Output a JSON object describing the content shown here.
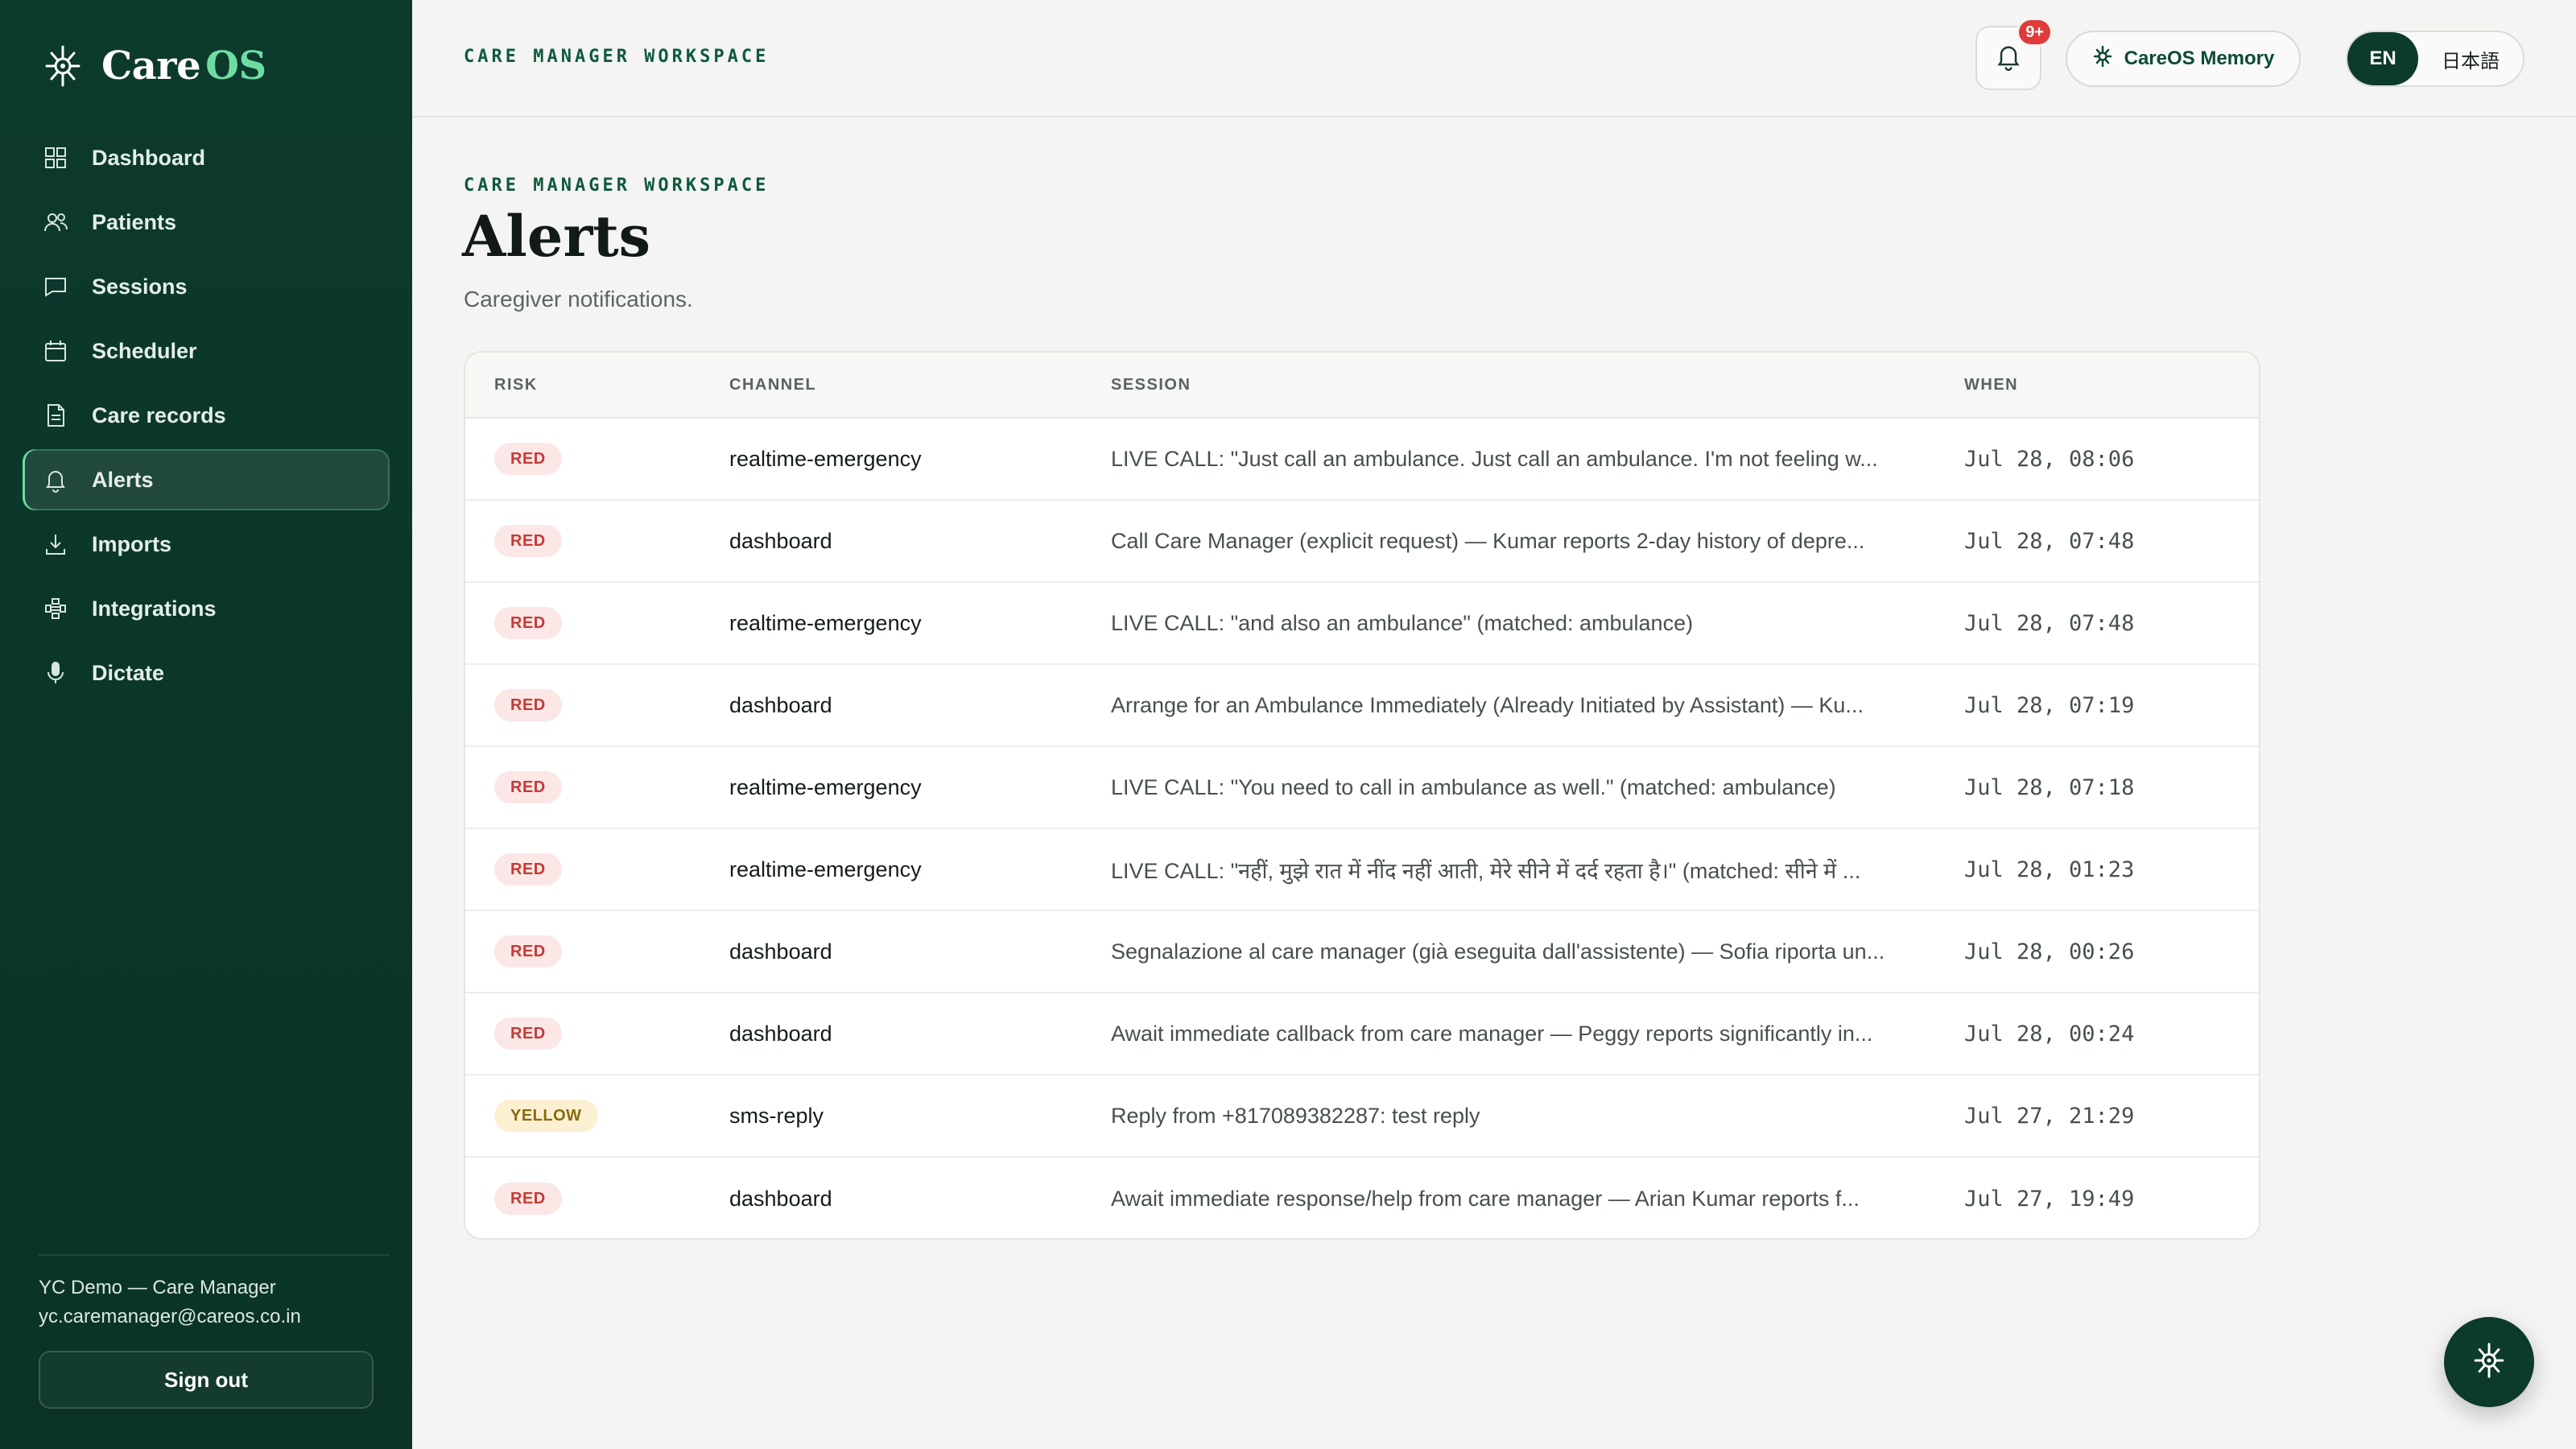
{
  "brand": {
    "name_part1": "Care",
    "name_part2": "OS"
  },
  "sidebar": {
    "items": [
      {
        "label": "Dashboard",
        "icon": "grid-icon"
      },
      {
        "label": "Patients",
        "icon": "users-icon"
      },
      {
        "label": "Sessions",
        "icon": "chat-icon"
      },
      {
        "label": "Scheduler",
        "icon": "calendar-icon"
      },
      {
        "label": "Care records",
        "icon": "document-icon"
      },
      {
        "label": "Alerts",
        "icon": "bell-icon",
        "active": true
      },
      {
        "label": "Imports",
        "icon": "download-icon"
      },
      {
        "label": "Integrations",
        "icon": "puzzle-icon"
      },
      {
        "label": "Dictate",
        "icon": "microphone-icon"
      }
    ],
    "user_name": "YC Demo — Care Manager",
    "user_email": "yc.caremanager@careos.co.in",
    "signout_label": "Sign out"
  },
  "header": {
    "label": "CARE MANAGER WORKSPACE",
    "notification_badge": "9+",
    "memory_label": "CareOS Memory",
    "lang_en": "EN",
    "lang_ja": "日本語"
  },
  "page": {
    "eyebrow": "CARE MANAGER WORKSPACE",
    "title": "Alerts",
    "subtitle": "Caregiver notifications."
  },
  "table": {
    "headers": {
      "risk": "RISK",
      "channel": "CHANNEL",
      "session": "SESSION",
      "when": "WHEN"
    },
    "rows": [
      {
        "risk": "RED",
        "channel": "realtime-emergency",
        "session": "LIVE CALL: \"Just call an ambulance. Just call an ambulance. I'm not feeling w...",
        "when": "Jul 28, 08:06"
      },
      {
        "risk": "RED",
        "channel": "dashboard",
        "session": "Call Care Manager (explicit request) — Kumar reports 2-day history of depre...",
        "when": "Jul 28, 07:48"
      },
      {
        "risk": "RED",
        "channel": "realtime-emergency",
        "session": "LIVE CALL: \"and also an ambulance\" (matched: ambulance)",
        "when": "Jul 28, 07:48"
      },
      {
        "risk": "RED",
        "channel": "dashboard",
        "session": "Arrange for an Ambulance Immediately (Already Initiated by Assistant) — Ku...",
        "when": "Jul 28, 07:19"
      },
      {
        "risk": "RED",
        "channel": "realtime-emergency",
        "session": "LIVE CALL: \"You need to call in ambulance as well.\" (matched: ambulance)",
        "when": "Jul 28, 07:18"
      },
      {
        "risk": "RED",
        "channel": "realtime-emergency",
        "session": "LIVE CALL: \"नहीं, मुझे रात में नींद नहीं आती, मेरे सीने में दर्द रहता है।\" (matched: सीने में ...",
        "when": "Jul 28, 01:23"
      },
      {
        "risk": "RED",
        "channel": "dashboard",
        "session": "Segnalazione al care manager (già eseguita dall'assistente) — Sofia riporta un...",
        "when": "Jul 28, 00:26"
      },
      {
        "risk": "RED",
        "channel": "dashboard",
        "session": "Await immediate callback from care manager — Peggy reports significantly in...",
        "when": "Jul 28, 00:24"
      },
      {
        "risk": "YELLOW",
        "channel": "sms-reply",
        "session": "Reply from +817089382287: test reply",
        "when": "Jul 27, 21:29"
      },
      {
        "risk": "RED",
        "channel": "dashboard",
        "session": "Await immediate response/help from care manager — Arian Kumar reports f...",
        "when": "Jul 27, 19:49"
      }
    ]
  },
  "colors": {
    "sidebar_bg": "#0c3a2c",
    "accent": "#6fdca4",
    "red_pill": "#c53a36",
    "yellow_pill": "#8a6a0c"
  },
  "fab_icon": "careos-logo-icon"
}
